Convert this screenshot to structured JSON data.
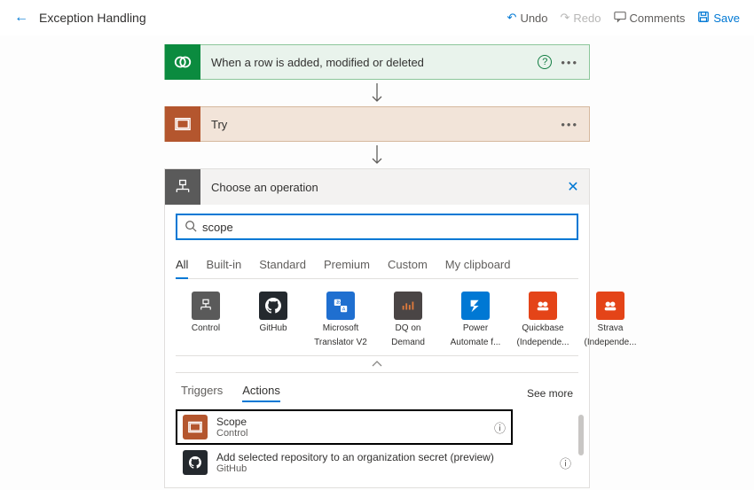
{
  "topbar": {
    "title": "Exception Handling",
    "undo": "Undo",
    "redo": "Redo",
    "comments": "Comments",
    "save": "Save"
  },
  "trigger": {
    "label": "When a row is added, modified or deleted"
  },
  "try_scope": {
    "label": "Try"
  },
  "panel": {
    "header": "Choose an operation",
    "search_value": "scope",
    "tabs": [
      "All",
      "Built-in",
      "Standard",
      "Premium",
      "Custom",
      "My clipboard"
    ],
    "active_tab": 0,
    "connectors": [
      {
        "name": "Control",
        "sub": "",
        "color": "#5a5a5a"
      },
      {
        "name": "GitHub",
        "sub": "",
        "color": "#24292e"
      },
      {
        "name": "Microsoft",
        "sub": "Translator V2",
        "color": "#1f6fd0"
      },
      {
        "name": "DQ on",
        "sub": "Demand",
        "color": "#4a4545"
      },
      {
        "name": "Power",
        "sub": "Automate f...",
        "color": "#0078d4"
      },
      {
        "name": "Quickbase",
        "sub": "(Independe...",
        "color": "#e44418"
      },
      {
        "name": "Strava",
        "sub": "(Independe...",
        "color": "#e44418"
      }
    ],
    "sub_tabs": {
      "triggers": "Triggers",
      "actions": "Actions",
      "seemore": "See more",
      "active": 1
    },
    "results": [
      {
        "title": "Scope",
        "sub": "Control",
        "color": "#b4562e"
      },
      {
        "title": "Add selected repository to an organization secret (preview)",
        "sub": "GitHub",
        "color": "#24292e"
      }
    ]
  }
}
